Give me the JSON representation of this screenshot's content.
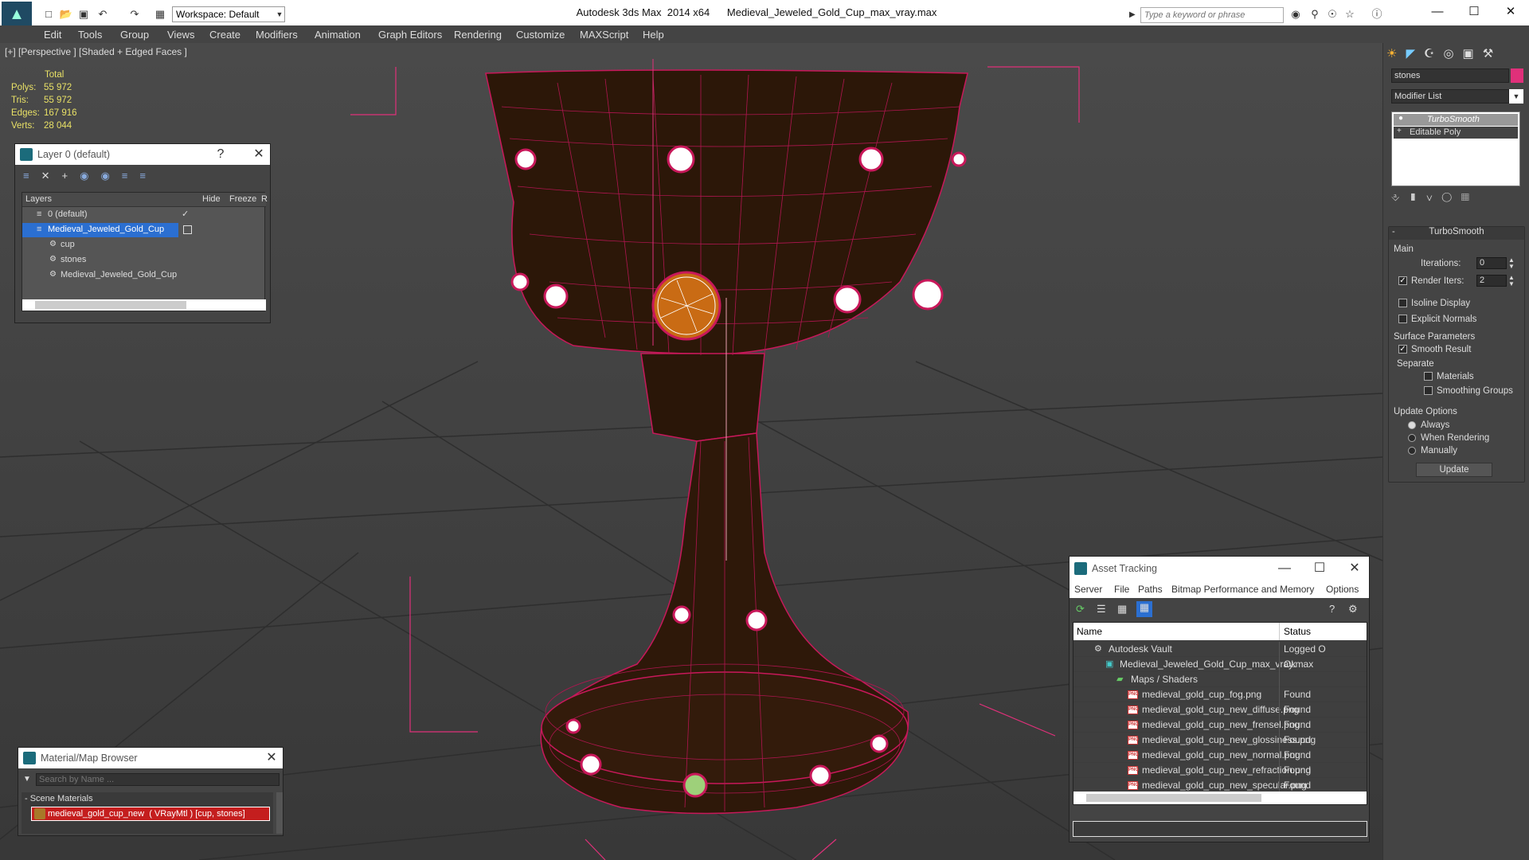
{
  "titlebar": {
    "app_title": "Autodesk 3ds Max  2014 x64      Medieval_Jeweled_Gold_Cup_max_vray.max",
    "workspace": "Workspace: Default",
    "search_placeholder": "Type a keyword or phrase"
  },
  "menus": [
    "Edit",
    "Tools",
    "Group",
    "Views",
    "Create",
    "Modifiers",
    "Animation",
    "Graph Editors",
    "Rendering",
    "Customize",
    "MAXScript",
    "Help"
  ],
  "viewport": {
    "label": "[+] [Perspective ] [Shaded + Edged Faces ]",
    "stats_header": "Total",
    "stats": [
      {
        "label": "Polys:",
        "value": "55 972"
      },
      {
        "label": "Tris:",
        "value": "55 972"
      },
      {
        "label": "Edges:",
        "value": "167 916"
      },
      {
        "label": "Verts:",
        "value": "28 044"
      }
    ]
  },
  "layer_panel": {
    "title": "Layer 0 (default)",
    "help": "?",
    "col_layers": "Layers",
    "col_hide": "Hide",
    "col_freeze": "Freeze",
    "col_r": "R",
    "rows": [
      {
        "label": "0 (default)",
        "indent": 0,
        "selected": false
      },
      {
        "label": "Medieval_Jeweled_Gold_Cup",
        "indent": 0,
        "selected": true
      },
      {
        "label": "cup",
        "indent": 1,
        "selected": false
      },
      {
        "label": "stones",
        "indent": 1,
        "selected": false
      },
      {
        "label": "Medieval_Jeweled_Gold_Cup",
        "indent": 1,
        "selected": false
      }
    ]
  },
  "material_browser": {
    "title": "Material/Map Browser",
    "search_placeholder": "Search by Name ...",
    "section": "- Scene Materials",
    "item": "medieval_gold_cup_new  ( VRayMtl ) [cup, stones]"
  },
  "command_panel": {
    "object_name": "stones",
    "modifier_list": "Modifier List",
    "stack": [
      "TurboSmooth",
      "Editable Poly"
    ],
    "rollout_title": "TurboSmooth",
    "main": "Main",
    "iterations_label": "Iterations:",
    "iterations_value": "0",
    "render_iters_label": "Render Iters:",
    "render_iters_value": "2",
    "isoline": "Isoline Display",
    "explicit_normals": "Explicit Normals",
    "surface_params": "Surface Parameters",
    "smooth_result": "Smooth Result",
    "separate": "Separate",
    "materials": "Materials",
    "smoothing_groups": "Smoothing Groups",
    "update_options": "Update Options",
    "always": "Always",
    "when_rendering": "When Rendering",
    "manually": "Manually",
    "update_btn": "Update"
  },
  "asset_tracking": {
    "title": "Asset Tracking",
    "menus": [
      "Server",
      "File",
      "Paths",
      "Bitmap Performance and Memory",
      "Options"
    ],
    "col_name": "Name",
    "col_status": "Status",
    "rows": [
      {
        "name": "Autodesk Vault",
        "status": "Logged O",
        "indent": 1,
        "icon": "vault"
      },
      {
        "name": "Medieval_Jeweled_Gold_Cup_max_vray.max",
        "status": "Ok",
        "indent": 2,
        "icon": "max"
      },
      {
        "name": "Maps / Shaders",
        "status": "",
        "indent": 3,
        "icon": "folder"
      },
      {
        "name": "medieval_gold_cup_fog.png",
        "status": "Found",
        "indent": 4,
        "icon": "png"
      },
      {
        "name": "medieval_gold_cup_new_diffuse.png",
        "status": "Found",
        "indent": 4,
        "icon": "png"
      },
      {
        "name": "medieval_gold_cup_new_frensel.png",
        "status": "Found",
        "indent": 4,
        "icon": "png"
      },
      {
        "name": "medieval_gold_cup_new_glossiness.png",
        "status": "Found",
        "indent": 4,
        "icon": "png"
      },
      {
        "name": "medieval_gold_cup_new_normal.png",
        "status": "Found",
        "indent": 4,
        "icon": "png"
      },
      {
        "name": "medieval_gold_cup_new_refraction.png",
        "status": "Found",
        "indent": 4,
        "icon": "png"
      },
      {
        "name": "medieval_gold_cup_new_specular.png",
        "status": "Found",
        "indent": 4,
        "icon": "png"
      }
    ]
  },
  "colors": {
    "selection": "#2b6fd1",
    "wire": "#c8185a",
    "accent": "#e0307a"
  }
}
